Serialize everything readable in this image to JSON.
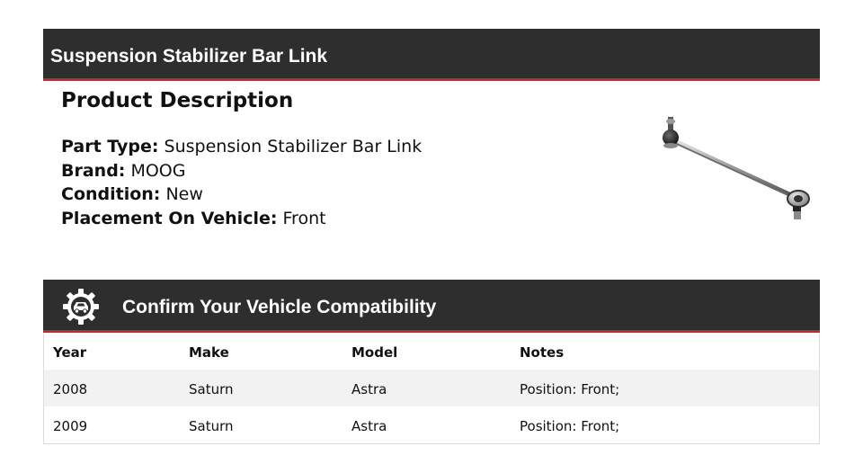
{
  "header": {
    "title": "Suspension Stabilizer Bar Link"
  },
  "description": {
    "heading": "Product Description",
    "attributes": [
      {
        "label": "Part Type:",
        "value": "Suspension Stabilizer Bar Link"
      },
      {
        "label": "Brand:",
        "value": "MOOG"
      },
      {
        "label": "Condition:",
        "value": "New"
      },
      {
        "label": "Placement On Vehicle:",
        "value": "Front"
      }
    ]
  },
  "compat": {
    "icon": "gear-car-icon",
    "title": "Confirm Your Vehicle Compatibility",
    "columns": [
      "Year",
      "Make",
      "Model",
      "Notes"
    ],
    "rows": [
      [
        "2008",
        "Saturn",
        "Astra",
        "Position: Front;"
      ],
      [
        "2009",
        "Saturn",
        "Astra",
        "Position: Front;"
      ]
    ]
  },
  "colors": {
    "banner_bg": "#2f2e2e",
    "accent": "#d6212b",
    "row_stripe": "#f2f2f2"
  }
}
